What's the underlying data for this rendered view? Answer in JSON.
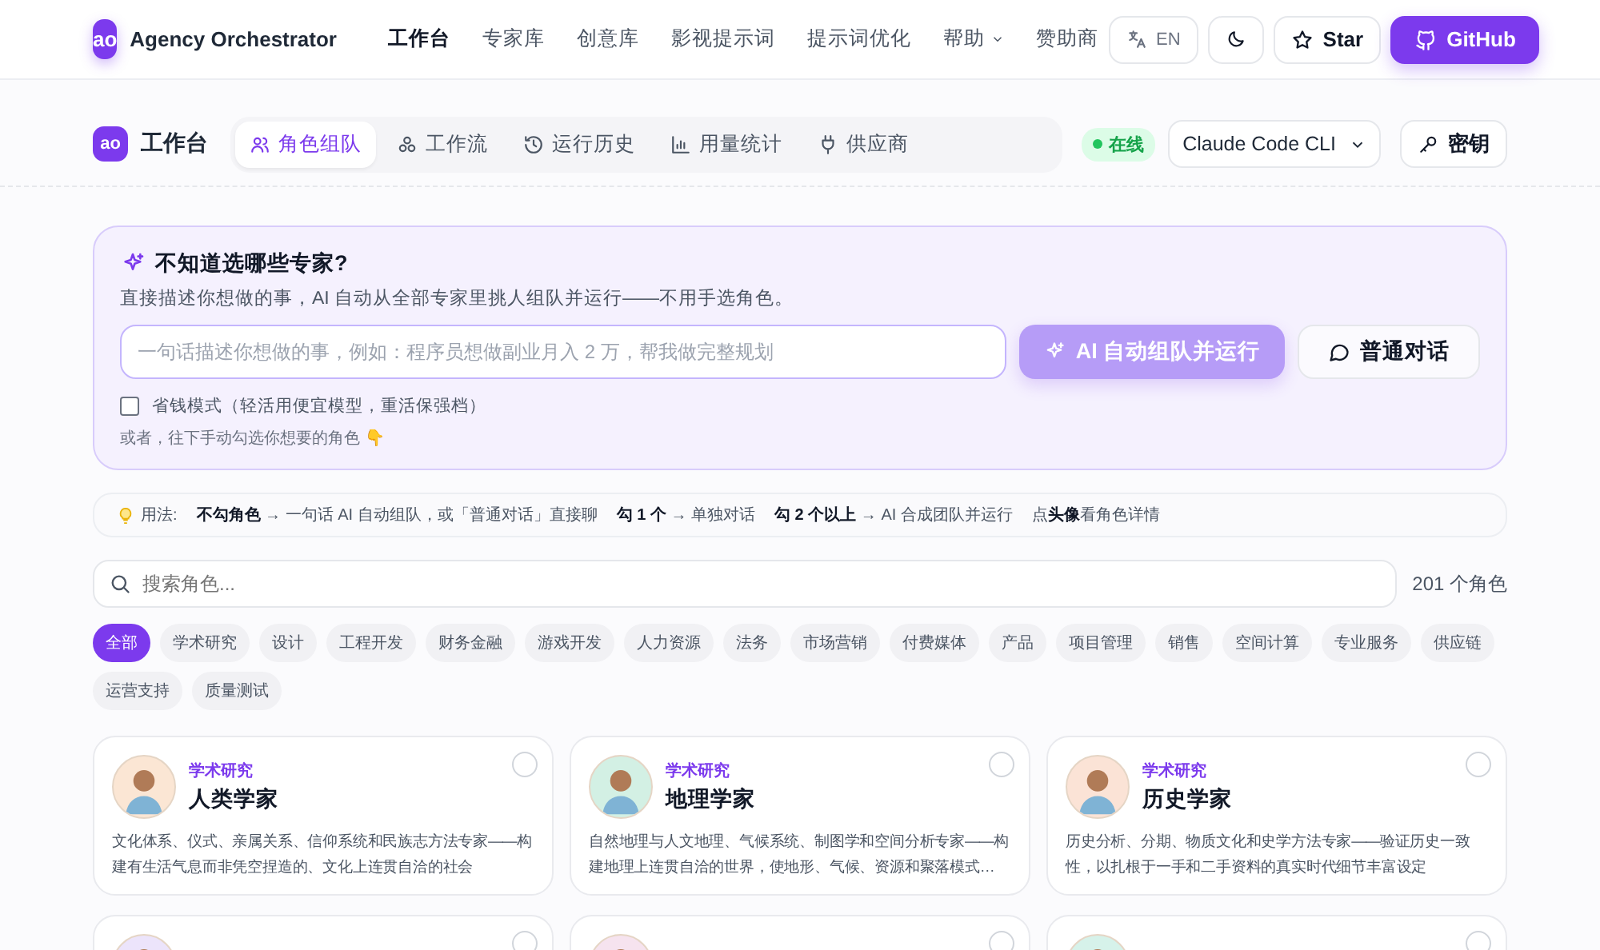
{
  "header": {
    "logo": "ao",
    "brand": "Agency Orchestrator",
    "nav": [
      {
        "label": "工作台",
        "selected": true,
        "kind": "link"
      },
      {
        "label": "专家库",
        "selected": false,
        "kind": "link"
      },
      {
        "label": "创意库",
        "selected": false,
        "kind": "link"
      },
      {
        "label": "影视提示词",
        "selected": false,
        "kind": "link"
      },
      {
        "label": "提示词优化",
        "selected": false,
        "kind": "link"
      },
      {
        "label": "帮助",
        "selected": false,
        "kind": "menu"
      },
      {
        "label": "赞助商",
        "selected": false,
        "kind": "link"
      }
    ],
    "lang": "EN",
    "star": "Star",
    "github": "GitHub"
  },
  "subbar": {
    "logo": "ao",
    "title": "工作台",
    "tabs": [
      {
        "label": "角色组队",
        "selected": true
      },
      {
        "label": "工作流",
        "selected": false
      },
      {
        "label": "运行历史",
        "selected": false
      },
      {
        "label": "用量统计",
        "selected": false
      },
      {
        "label": "供应商",
        "selected": false
      }
    ],
    "status": "在线",
    "provider": "Claude Code CLI",
    "keys": "密钥"
  },
  "hero": {
    "title": "不知道选哪些专家?",
    "subtitle": "直接描述你想做的事，AI 自动从全部专家里挑人组队并运行——不用手选角色。",
    "input_placeholder": "一句话描述你想做的事，例如：程序员想做副业月入 2 万，帮我做完整规划",
    "run_button": "AI 自动组队并运行",
    "chat_button": "普通对话",
    "saver": {
      "label": "省钱模式（轻活用便宜模型，重活保强档）",
      "checked": false
    },
    "hint": "或者，往下手动勾选你想要的角色 👇"
  },
  "tips": {
    "label": "用法:",
    "items": [
      "**不勾角色** → 一句话 AI 自动组队，或「普通对话」直接聊",
      "**勾 1 个** → 单独对话",
      "**勾 2 个以上** → AI 合成团队并运行",
      "点**头像**看角色详情"
    ]
  },
  "search": {
    "placeholder": "搜索角色...",
    "count": "201 个角色"
  },
  "categories": [
    {
      "label": "全部",
      "selected": true
    },
    {
      "label": "学术研究",
      "selected": false
    },
    {
      "label": "设计",
      "selected": false
    },
    {
      "label": "工程开发",
      "selected": false
    },
    {
      "label": "财务金融",
      "selected": false
    },
    {
      "label": "游戏开发",
      "selected": false
    },
    {
      "label": "人力资源",
      "selected": false
    },
    {
      "label": "法务",
      "selected": false
    },
    {
      "label": "市场营销",
      "selected": false
    },
    {
      "label": "付费媒体",
      "selected": false
    },
    {
      "label": "产品",
      "selected": false
    },
    {
      "label": "项目管理",
      "selected": false
    },
    {
      "label": "销售",
      "selected": false
    },
    {
      "label": "空间计算",
      "selected": false
    },
    {
      "label": "专业服务",
      "selected": false
    },
    {
      "label": "供应链",
      "selected": false
    },
    {
      "label": "运营支持",
      "selected": false
    },
    {
      "label": "质量测试",
      "selected": false
    }
  ],
  "roles": [
    {
      "category": "学术研究",
      "name": "人类学家",
      "description": "文化体系、仪式、亲属关系、信仰系统和民族志方法专家——构建有生活气息而非凭空捏造的、文化上连贯自洽的社会",
      "checked": false,
      "color": "#fbe6d4"
    },
    {
      "category": "学术研究",
      "name": "地理学家",
      "description": "自然地理与人文地理、气候系统、制图学和空间分析专家——构建地理上连贯自洽的世界，使地形、气候、资源和聚落模式…",
      "checked": false,
      "color": "#d3f0e4"
    },
    {
      "category": "学术研究",
      "name": "历史学家",
      "description": "历史分析、分期、物质文化和史学方法专家——验证历史一致性，以扎根于一手和二手资料的真实时代细节丰富设定",
      "checked": false,
      "color": "#fbe3d6"
    },
    {
      "checked": false,
      "color": "#ece4fb"
    },
    {
      "checked": false,
      "color": "#f6e3ef"
    },
    {
      "checked": false,
      "color": "#d6f2ea"
    }
  ]
}
